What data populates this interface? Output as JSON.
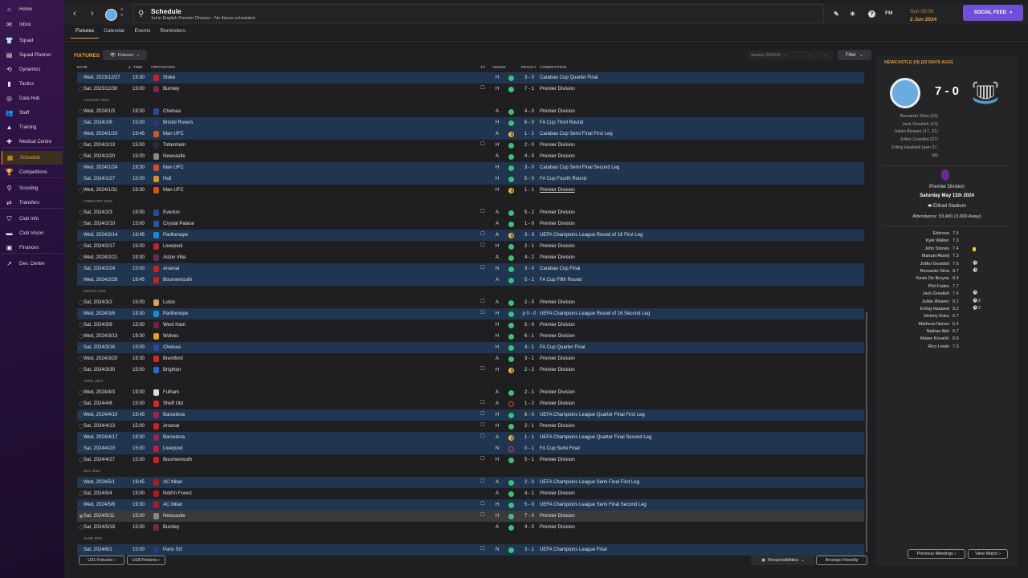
{
  "sidebar": {
    "items": [
      {
        "label": "Home",
        "icon": "home-icon",
        "glyph": "⌂"
      },
      {
        "label": "Inbox",
        "icon": "inbox-icon",
        "glyph": "✉"
      },
      {
        "label": "Squad",
        "icon": "shirt-icon",
        "glyph": "👕"
      },
      {
        "label": "Squad Planner",
        "icon": "clipboard-icon",
        "glyph": "▤"
      },
      {
        "label": "Dynamics",
        "icon": "dynamics-icon",
        "glyph": "⟲"
      },
      {
        "label": "Tactics",
        "icon": "tactics-icon",
        "glyph": "▮"
      },
      {
        "label": "Data Hub",
        "icon": "data-hub-icon",
        "glyph": "◎"
      },
      {
        "label": "Staff",
        "icon": "staff-icon",
        "glyph": "👥"
      },
      {
        "label": "Training",
        "icon": "training-icon",
        "glyph": "▲"
      },
      {
        "label": "Medical Centre",
        "icon": "medical-icon",
        "glyph": "✚"
      },
      {
        "label": "Schedule",
        "icon": "calendar-icon",
        "glyph": "▦",
        "active": true
      },
      {
        "label": "Competitions",
        "icon": "trophy-icon",
        "glyph": "🏆"
      },
      {
        "label": "Scouting",
        "icon": "search-icon",
        "glyph": "⚲"
      },
      {
        "label": "Transfers",
        "icon": "transfers-icon",
        "glyph": "⇄"
      },
      {
        "label": "Club Info",
        "icon": "shield-icon",
        "glyph": "⛉"
      },
      {
        "label": "Club Vision",
        "icon": "briefcase-icon",
        "glyph": "▬"
      },
      {
        "label": "Finances",
        "icon": "money-icon",
        "glyph": "▣"
      },
      {
        "label": "Dev. Centre",
        "icon": "dev-centre-icon",
        "glyph": "↗"
      }
    ]
  },
  "header": {
    "title": "Schedule",
    "subtitle": "1st in English Premier Division - No fixture scheduled.",
    "time": "Sun 00:00",
    "date": "2 Jun 2024",
    "fm_label": "FM",
    "social_feed": "SOCIAL FEED"
  },
  "tabs": [
    "Fixtures",
    "Calendar",
    "Events",
    "Reminders"
  ],
  "toolbar": {
    "section_label": "FIXTURES",
    "view_dropdown": "Fixtures",
    "season": "Season 2023/24",
    "filter": "Filter"
  },
  "columns": {
    "date": "DATE",
    "time": "TIME",
    "opposition": "OPPOSITION",
    "tv": "TV",
    "venue": "VENUE",
    "result": "RESULT",
    "competition": "COMPETITION"
  },
  "colors": {
    "accent": "#f0a030",
    "win": "#3bc17a",
    "draw": "#e8b34a",
    "loss": "#e04050",
    "cup_row": "#1f3550",
    "social": "#6e4fd8"
  },
  "fixtures": [
    {
      "date": "Wed, 2023/12/27",
      "time": "19:30",
      "opp": "Stoke",
      "tv": false,
      "venue": "H",
      "res": "W",
      "result": "3 - 0",
      "comp": "Carabao Cup Quarter Final",
      "badge": "#d02030"
    },
    {
      "date": "Sat, 2023/12/30",
      "time": "15:00",
      "opp": "Burnley",
      "tv": true,
      "venue": "H",
      "res": "W",
      "result": "7 - 1",
      "comp": "Premier Division",
      "badge": "#7a2848"
    },
    {
      "month": "JANUARY 2024"
    },
    {
      "date": "Wed, 2024/1/3",
      "time": "19:30",
      "opp": "Chelsea",
      "tv": false,
      "venue": "A",
      "res": "W",
      "result": "4 - 0",
      "comp": "Premier Division",
      "badge": "#2a4aa0"
    },
    {
      "date": "Sat, 2024/1/6",
      "time": "15:00",
      "opp": "Bristol Rovers",
      "tv": false,
      "venue": "H",
      "res": "W",
      "result": "6 - 0",
      "comp": "FA Cup Third Round",
      "badge": "#2a3a70"
    },
    {
      "date": "Wed, 2024/1/10",
      "time": "19:45",
      "opp": "Man UFC",
      "tv": false,
      "venue": "A",
      "res": "D",
      "result": "1 - 1",
      "comp": "Carabao Cup Semi Final First Leg",
      "badge": "#d8501a"
    },
    {
      "date": "Sat, 2024/1/13",
      "time": "15:00",
      "opp": "Tottenham",
      "tv": true,
      "venue": "H",
      "res": "W",
      "result": "2 - 0",
      "comp": "Premier Division",
      "badge": "#2a2a40"
    },
    {
      "date": "Sat, 2024/1/20",
      "time": "15:00",
      "opp": "Newcastle",
      "tv": false,
      "venue": "A",
      "res": "W",
      "result": "4 - 0",
      "comp": "Premier Division",
      "badge": "#888888"
    },
    {
      "date": "Wed, 2024/1/24",
      "time": "19:30",
      "opp": "Man UFC",
      "tv": false,
      "venue": "H",
      "res": "W",
      "result": "3 - 0",
      "comp": "Carabao Cup Semi Final Second Leg",
      "badge": "#d8501a"
    },
    {
      "date": "Sat, 2024/1/27",
      "time": "15:00",
      "opp": "Hull",
      "tv": false,
      "venue": "H",
      "res": "W",
      "result": "5 - 0",
      "comp": "FA Cup Fourth Round",
      "badge": "#d89020"
    },
    {
      "date": "Wed, 2024/1/31",
      "time": "19:30",
      "opp": "Man UFC",
      "tv": false,
      "venue": "H",
      "res": "D",
      "result": "1 - 1",
      "comp": "Premier Division",
      "badge": "#d8501a",
      "underline": true
    },
    {
      "month": "FEBRUARY 2024"
    },
    {
      "date": "Sat, 2024/2/3",
      "time": "15:00",
      "opp": "Everton",
      "tv": true,
      "venue": "A",
      "res": "W",
      "result": "5 - 2",
      "comp": "Premier Division",
      "badge": "#2a4aa0"
    },
    {
      "date": "Sat, 2024/2/10",
      "time": "15:00",
      "opp": "Crystal Palace",
      "tv": false,
      "venue": "A",
      "res": "W",
      "result": "1 - 0",
      "comp": "Premier Division",
      "badge": "#3050a0"
    },
    {
      "date": "Wed, 2024/2/14",
      "time": "19:45",
      "opp": "Parthenope",
      "tv": true,
      "venue": "A",
      "res": "D",
      "result": "3 - 3",
      "comp": "UEFA Champions League Round of 16 First Leg",
      "badge": "#1a8ad8"
    },
    {
      "date": "Sat, 2024/2/17",
      "time": "15:00",
      "opp": "Liverpool",
      "tv": true,
      "venue": "H",
      "res": "W",
      "result": "2 - 1",
      "comp": "Premier Division",
      "badge": "#c02030"
    },
    {
      "date": "Wed, 2024/2/21",
      "time": "19:30",
      "opp": "Aston Villa",
      "tv": false,
      "venue": "A",
      "res": "W",
      "result": "4 - 2",
      "comp": "Premier Division",
      "badge": "#6a2a5a"
    },
    {
      "date": "Sat, 2024/2/24",
      "time": "15:00",
      "opp": "Arsenal",
      "tv": true,
      "venue": "N",
      "res": "W",
      "result": "3 - 0",
      "comp": "Carabao Cup Final",
      "badge": "#d02020"
    },
    {
      "date": "Wed, 2024/2/28",
      "time": "19:45",
      "opp": "Bournemouth",
      "tv": false,
      "venue": "A",
      "res": "W",
      "result": "5 - 1",
      "comp": "FA Cup Fifth Round",
      "badge": "#c82020"
    },
    {
      "month": "MARCH 2024"
    },
    {
      "date": "Sat, 2024/3/2",
      "time": "15:00",
      "opp": "Luton",
      "tv": true,
      "venue": "A",
      "res": "W",
      "result": "2 - 0",
      "comp": "Premier Division",
      "badge": "#d8a060"
    },
    {
      "date": "Wed, 2024/3/6",
      "time": "19:30",
      "opp": "Parthenope",
      "tv": true,
      "venue": "H",
      "res": "W",
      "result": "p 0 - 0",
      "comp": "UEFA Champions League Round of 16 Second Leg",
      "badge": "#1a8ad8"
    },
    {
      "date": "Sat, 2024/3/9",
      "time": "15:00",
      "opp": "West Ham",
      "tv": false,
      "venue": "H",
      "res": "W",
      "result": "5 - 0",
      "comp": "Premier Division",
      "badge": "#7a2040"
    },
    {
      "date": "Wed, 2024/3/13",
      "time": "19:30",
      "opp": "Wolves",
      "tv": false,
      "venue": "H",
      "res": "W",
      "result": "6 - 1",
      "comp": "Premier Division",
      "badge": "#e0a020"
    },
    {
      "date": "Sat, 2024/3/16",
      "time": "15:00",
      "opp": "Chelsea",
      "tv": false,
      "venue": "H",
      "res": "W",
      "result": "4 - 1",
      "comp": "FA Cup Quarter Final",
      "badge": "#2a4aa0"
    },
    {
      "date": "Wed, 2024/3/20",
      "time": "19:30",
      "opp": "Brentford",
      "tv": false,
      "venue": "A",
      "res": "W",
      "result": "3 - 1",
      "comp": "Premier Division",
      "badge": "#d02828"
    },
    {
      "date": "Sat, 2024/3/30",
      "time": "15:00",
      "opp": "Brighton",
      "tv": true,
      "venue": "H",
      "res": "D",
      "result": "2 - 2",
      "comp": "Premier Division",
      "badge": "#2a6ad0"
    },
    {
      "month": "APRIL 2024"
    },
    {
      "date": "Wed, 2024/4/3",
      "time": "19:30",
      "opp": "Fulham",
      "tv": false,
      "venue": "A",
      "res": "W",
      "result": "2 - 1",
      "comp": "Premier Division",
      "badge": "#dddddd"
    },
    {
      "date": "Sat, 2024/4/6",
      "time": "15:00",
      "opp": "Sheff Utd",
      "tv": true,
      "venue": "A",
      "res": "L",
      "result": "1 - 2",
      "comp": "Premier Division",
      "badge": "#d02828"
    },
    {
      "date": "Wed, 2024/4/10",
      "time": "19:45",
      "opp": "Barcelona",
      "tv": true,
      "venue": "H",
      "res": "W",
      "result": "6 - 0",
      "comp": "UEFA Champions League Quarter Final First Leg",
      "badge": "#a02050"
    },
    {
      "date": "Sat, 2024/4/13",
      "time": "15:00",
      "opp": "Arsenal",
      "tv": true,
      "venue": "H",
      "res": "W",
      "result": "2 - 1",
      "comp": "Premier Division",
      "badge": "#d02020"
    },
    {
      "date": "Wed, 2024/4/17",
      "time": "19:30",
      "opp": "Barcelona",
      "tv": true,
      "venue": "A",
      "res": "D",
      "result": "1 - 1",
      "comp": "UEFA Champions League Quarter Final Second Leg",
      "badge": "#a02050"
    },
    {
      "date": "Sat, 2024/4/20",
      "time": "15:00",
      "opp": "Liverpool",
      "tv": false,
      "venue": "N",
      "res": "L",
      "result": "0 - 1",
      "comp": "FA Cup Semi Final",
      "badge": "#c02030"
    },
    {
      "date": "Sat, 2024/4/27",
      "time": "15:00",
      "opp": "Bournemouth",
      "tv": true,
      "venue": "H",
      "res": "W",
      "result": "5 - 1",
      "comp": "Premier Division",
      "badge": "#c82020"
    },
    {
      "month": "MAY 2024"
    },
    {
      "date": "Wed, 2024/5/1",
      "time": "19:45",
      "opp": "AC Milan",
      "tv": true,
      "venue": "A",
      "res": "W",
      "result": "2 - 0",
      "comp": "UEFA Champions League Semi Final First Leg",
      "badge": "#b01820"
    },
    {
      "date": "Sat, 2024/5/4",
      "time": "15:00",
      "opp": "Nott'm Forest",
      "tv": false,
      "venue": "A",
      "res": "W",
      "result": "4 - 1",
      "comp": "Premier Division",
      "badge": "#b01820"
    },
    {
      "date": "Wed, 2024/5/8",
      "time": "19:30",
      "opp": "AC Milan",
      "tv": true,
      "venue": "H",
      "res": "W",
      "result": "5 - 0",
      "comp": "UEFA Champions League Semi Final Second Leg",
      "badge": "#b01820"
    },
    {
      "date": "Sat, 2024/5/11",
      "time": "15:00",
      "opp": "Newcastle",
      "tv": true,
      "venue": "H",
      "res": "W",
      "result": "7 - 0",
      "comp": "Premier Division",
      "badge": "#888888",
      "selected": true
    },
    {
      "date": "Sat, 2024/5/18",
      "time": "15:00",
      "opp": "Burnley",
      "tv": false,
      "venue": "A",
      "res": "W",
      "result": "4 - 0",
      "comp": "Premier Division",
      "badge": "#7a2848"
    },
    {
      "month": "JUNE 2024"
    },
    {
      "date": "Sat, 2024/6/1",
      "time": "15:00",
      "opp": "Paris SG",
      "tv": true,
      "venue": "N",
      "res": "W",
      "result": "3 - 1",
      "comp": "UEFA Champions League Final",
      "badge": "#2a3a80"
    }
  ],
  "footer": {
    "u21": "U21 Fixtures",
    "u18": "U18 Fixtures",
    "responsibilities": "Responsibilities",
    "arrange": "Arrange Friendly"
  },
  "match_panel": {
    "heading": "NEWCASTLE (H) (22 DAYS AGO)",
    "score": "7 - 0",
    "scorers": [
      "Bernardo Silva (10)",
      "Jack Grealish (12)",
      "Julián Álvarez (17, 31)",
      "Joško Gvardiol (27)",
      "Erling Haaland (pen 37,",
      "48)"
    ],
    "competition": "Premier Division",
    "date": "Saturday May 11th 2024",
    "stadium": "Etihad Stadium",
    "attendance": "Attendance: 53,400 (3,000 Away)",
    "players": [
      {
        "name": "Ederson",
        "rating": "7.5"
      },
      {
        "name": "Kyle Walker",
        "rating": "7.3"
      },
      {
        "name": "John Stones",
        "rating": "7.4",
        "event": "yellow-card"
      },
      {
        "name": "Manuel Akanji",
        "rating": "7.3"
      },
      {
        "name": "Joško Gvardiol",
        "rating": "7.6",
        "event": "goal"
      },
      {
        "name": "Bernardo Silva",
        "rating": "8.7",
        "event": "goal"
      },
      {
        "name": "Kevin De Bruyne",
        "rating": "8.4"
      },
      {
        "name": "Phil Foden",
        "rating": "7.7"
      },
      {
        "name": "Jack Grealish",
        "rating": "7.4",
        "event": "goal"
      },
      {
        "name": "Julián Álvarez",
        "rating": "9.1",
        "event": "goal",
        "count": "2"
      },
      {
        "name": "Erling Haaland",
        "rating": "9.2",
        "event": "goal",
        "count": "2"
      },
      {
        "name": "Jérémy Doku",
        "rating": "6.7"
      },
      {
        "name": "Matheus Nunes",
        "rating": "6.4"
      },
      {
        "name": "Nathan Aké",
        "rating": "6.7"
      },
      {
        "name": "Mateo Kovačić",
        "rating": "6.6"
      },
      {
        "name": "Rico Lewis",
        "rating": "7.3"
      }
    ],
    "prev_meetings": "Previous Meetings",
    "view_match": "View Match"
  }
}
